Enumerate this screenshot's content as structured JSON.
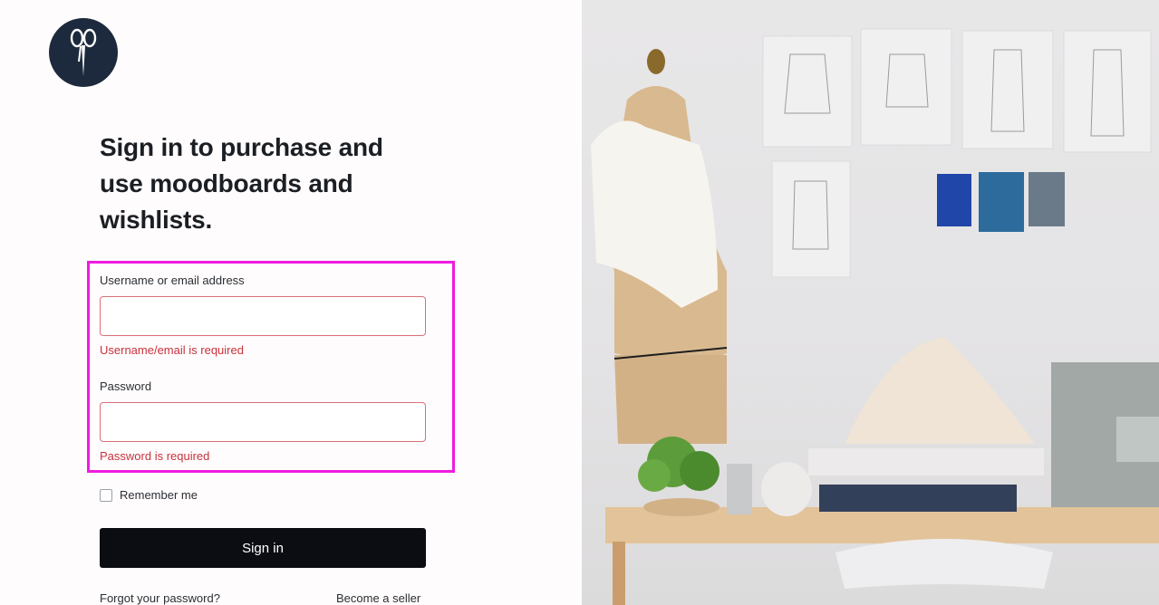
{
  "logo": {
    "icon": "scissors-icon",
    "bg_color": "#1d2a3d"
  },
  "heading": "Sign in to purchase and use moodboards and wishlists.",
  "form": {
    "username_label": "Username or email address",
    "username_value": "",
    "username_error": "Username/email is required",
    "password_label": "Password",
    "password_value": "",
    "password_error": "Password is required",
    "remember_label": "Remember me",
    "remember_checked": false,
    "signin_label": "Sign in",
    "forgot_link": "Forgot your password?",
    "seller_link": "Become a seller"
  },
  "colors": {
    "accent": "#0b0d12",
    "error": "#c8323c",
    "highlight": "#ee1ce0"
  },
  "photo": {
    "subject": "sewing studio with dress form, sketches, plant and sewing machine"
  }
}
